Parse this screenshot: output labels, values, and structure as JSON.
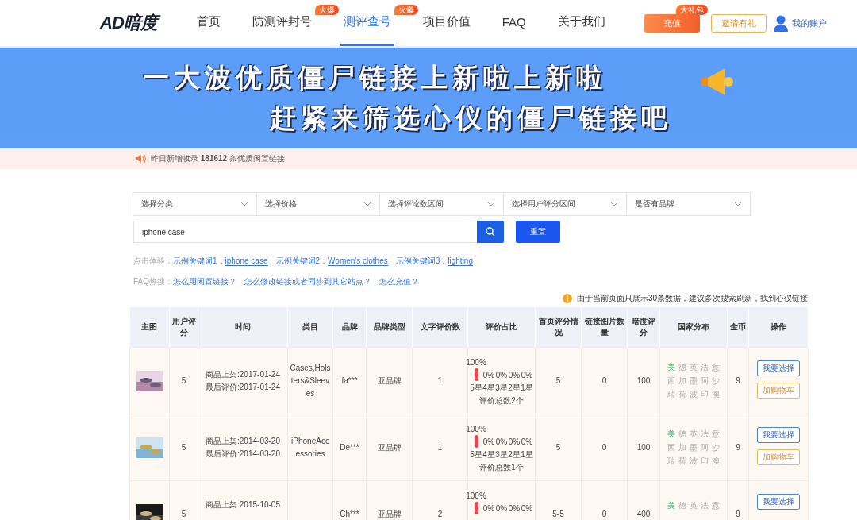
{
  "header": {
    "logo": "AD暗度",
    "nav": [
      {
        "label": "首页",
        "selected": false
      },
      {
        "label": "防测评封号",
        "selected": false,
        "badge": "火爆"
      },
      {
        "label": "测评查号",
        "selected": true,
        "badge": "火爆"
      },
      {
        "label": "项目价值",
        "selected": false
      },
      {
        "label": "FAQ",
        "selected": false
      },
      {
        "label": "关于我们",
        "selected": false
      }
    ],
    "recharge": {
      "label": "充值",
      "badge": "大礼包"
    },
    "invite": "邀请有礼",
    "account": "我的账户"
  },
  "banner": {
    "line1": "一大波**优质僵尸链接**上新啦上新啦",
    "line2": "赶紧来筛选心仪的僵尸链接吧"
  },
  "notice": "昨日新增收录 **181612** 条优质闲置链接",
  "filters": [
    "选择分类",
    "选择价格",
    "选择评论数区间",
    "选择用户评分区间",
    "是否有品牌"
  ],
  "search": {
    "value": "iphone case",
    "reset": "重置"
  },
  "examples": {
    "prefix": "点击体验：",
    "items": [
      {
        "label": "示例关键词1：",
        "keyword": "iphone case"
      },
      {
        "label": "示例关键词2：",
        "keyword": "Women's clothes"
      },
      {
        "label": "示例关键词3：",
        "keyword": "lighting"
      }
    ]
  },
  "faq": {
    "prefix": "FAQ热搜：",
    "links": [
      "怎么用闲置链接？",
      "怎么修改链接或者同步到其它站点？",
      "怎么充值？"
    ]
  },
  "tip": "由于当前页面只展示30条数据，建议多次搜索刷新，找到心仪链接",
  "table": {
    "columns": [
      "主图",
      "用户评分",
      "时间",
      "类目",
      "品牌",
      "品牌类型",
      "文字评价数",
      "评价占比",
      "首页评分情况",
      "链接图片数量",
      "暗度评分",
      "国家分布",
      "金币",
      "操作"
    ],
    "rows": [
      {
        "kind": "picture",
        "score": "5",
        "listed": "商品上架:2017-01-24",
        "last": "最后评价:2017-01-24",
        "category": "Cases,Holsters&Sleeves",
        "brand": "fa***",
        "brand_type": "亚品牌",
        "reviews": "1",
        "ratio": {
          "bars": [
            {
              "pct": "100%",
              "star": "5星"
            },
            {
              "pct": "0%",
              "star": "4星"
            },
            {
              "pct": "0%",
              "star": "3星"
            },
            {
              "pct": "0%",
              "star": "2星"
            },
            {
              "pct": "0%",
              "star": "1星"
            }
          ],
          "total": "评价总数2个"
        },
        "home": "5",
        "pics": "0",
        "dark": "100",
        "countries": [
          {
            "name": "美",
            "active": true
          },
          {
            "name": "德",
            "active": false
          },
          {
            "name": "英",
            "active": false
          },
          {
            "name": "法",
            "active": false
          },
          {
            "name": "意",
            "active": false
          },
          {
            "name": "西",
            "active": false
          },
          {
            "name": "加",
            "active": false
          },
          {
            "name": "墨",
            "active": false
          },
          {
            "name": "阿",
            "active": false
          },
          {
            "name": "沙",
            "active": false
          },
          {
            "name": "瑞",
            "active": false
          },
          {
            "name": "荷",
            "active": false
          },
          {
            "name": "波",
            "active": false
          },
          {
            "name": "印",
            "active": false
          },
          {
            "name": "澳",
            "active": false
          }
        ],
        "coins": "9",
        "actions": [
          "我要选择",
          "加购物车"
        ]
      },
      {
        "kind": "picture",
        "score": "5",
        "listed": "商品上架:2014-03-20",
        "last": "最后评价:2014-03-20",
        "category": "iPhoneAccessories",
        "brand": "De***",
        "brand_type": "亚品牌",
        "reviews": "1",
        "ratio": {
          "bars": [
            {
              "pct": "100%",
              "star": "5星"
            },
            {
              "pct": "0%",
              "star": "4星"
            },
            {
              "pct": "0%",
              "star": "3星"
            },
            {
              "pct": "0%",
              "star": "2星"
            },
            {
              "pct": "0%",
              "star": "1星"
            }
          ],
          "total": "评价总数1个"
        },
        "home": "5",
        "pics": "0",
        "dark": "100",
        "countries": [
          {
            "name": "美",
            "active": true
          },
          {
            "name": "德",
            "active": false
          },
          {
            "name": "英",
            "active": false
          },
          {
            "name": "法",
            "active": false
          },
          {
            "name": "意",
            "active": false
          },
          {
            "name": "西",
            "active": false
          },
          {
            "name": "加",
            "active": false
          },
          {
            "name": "墨",
            "active": false
          },
          {
            "name": "阿",
            "active": false
          },
          {
            "name": "沙",
            "active": false
          },
          {
            "name": "瑞",
            "active": false
          },
          {
            "name": "荷",
            "active": false
          },
          {
            "name": "波",
            "active": false
          },
          {
            "name": "印",
            "active": false
          },
          {
            "name": "澳",
            "active": false
          }
        ],
        "coins": "9",
        "actions": [
          "我要选择",
          "加购物车"
        ]
      },
      {
        "kind": "picture",
        "score": "5",
        "listed": "商品上架:2015-10-05",
        "brand": "Ch***",
        "brand_type": "亚品牌",
        "reviews": "2",
        "ratio": {
          "bars": [
            {
              "pct": "100%"
            },
            {
              "pct": "0%"
            },
            {
              "pct": "0%"
            },
            {
              "pct": "0%"
            },
            {
              "pct": "0%"
            }
          ]
        },
        "home": "5-5",
        "pics": "0",
        "dark": "400",
        "countries": [
          {
            "name": "美",
            "active": true
          },
          {
            "name": "德",
            "active": false
          },
          {
            "name": "英",
            "active": false
          },
          {
            "name": "法",
            "active": false
          },
          {
            "name": "意",
            "active": false
          }
        ],
        "coins": "9",
        "actions": [
          "我要选择"
        ]
      }
    ]
  }
}
